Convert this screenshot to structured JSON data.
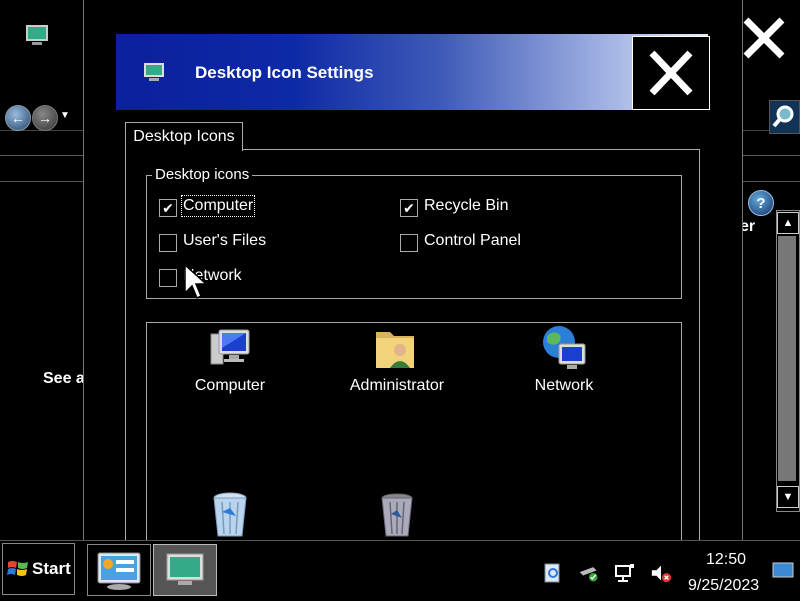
{
  "dialog": {
    "title": "Desktop Icon Settings",
    "tab": "Desktop Icons",
    "group_label": "Desktop icons",
    "checkboxes": [
      {
        "label": "Computer",
        "checked": true
      },
      {
        "label": "Recycle Bin",
        "checked": true
      },
      {
        "label": "User's Files",
        "checked": false
      },
      {
        "label": "Control Panel",
        "checked": false
      },
      {
        "label": "Network",
        "checked": false
      }
    ],
    "icons": [
      {
        "label": "Computer",
        "icon": "computer-icon"
      },
      {
        "label": "Administrator",
        "icon": "user-folder-icon"
      },
      {
        "label": "Network",
        "icon": "network-icon"
      },
      {
        "label": "",
        "icon": "recycle-bin-full-icon"
      },
      {
        "label": "",
        "icon": "recycle-bin-empty-icon"
      }
    ]
  },
  "background_window": {
    "right_text": "er",
    "see_also": "See a"
  },
  "taskbar": {
    "start_label": "Start",
    "time": "12:50",
    "date": "9/25/2023"
  },
  "colors": {
    "title_gradient_start": "#0c1f9c",
    "title_gradient_end": "#e8ecfa",
    "link": "#1b1bb3",
    "background": "#000000"
  }
}
